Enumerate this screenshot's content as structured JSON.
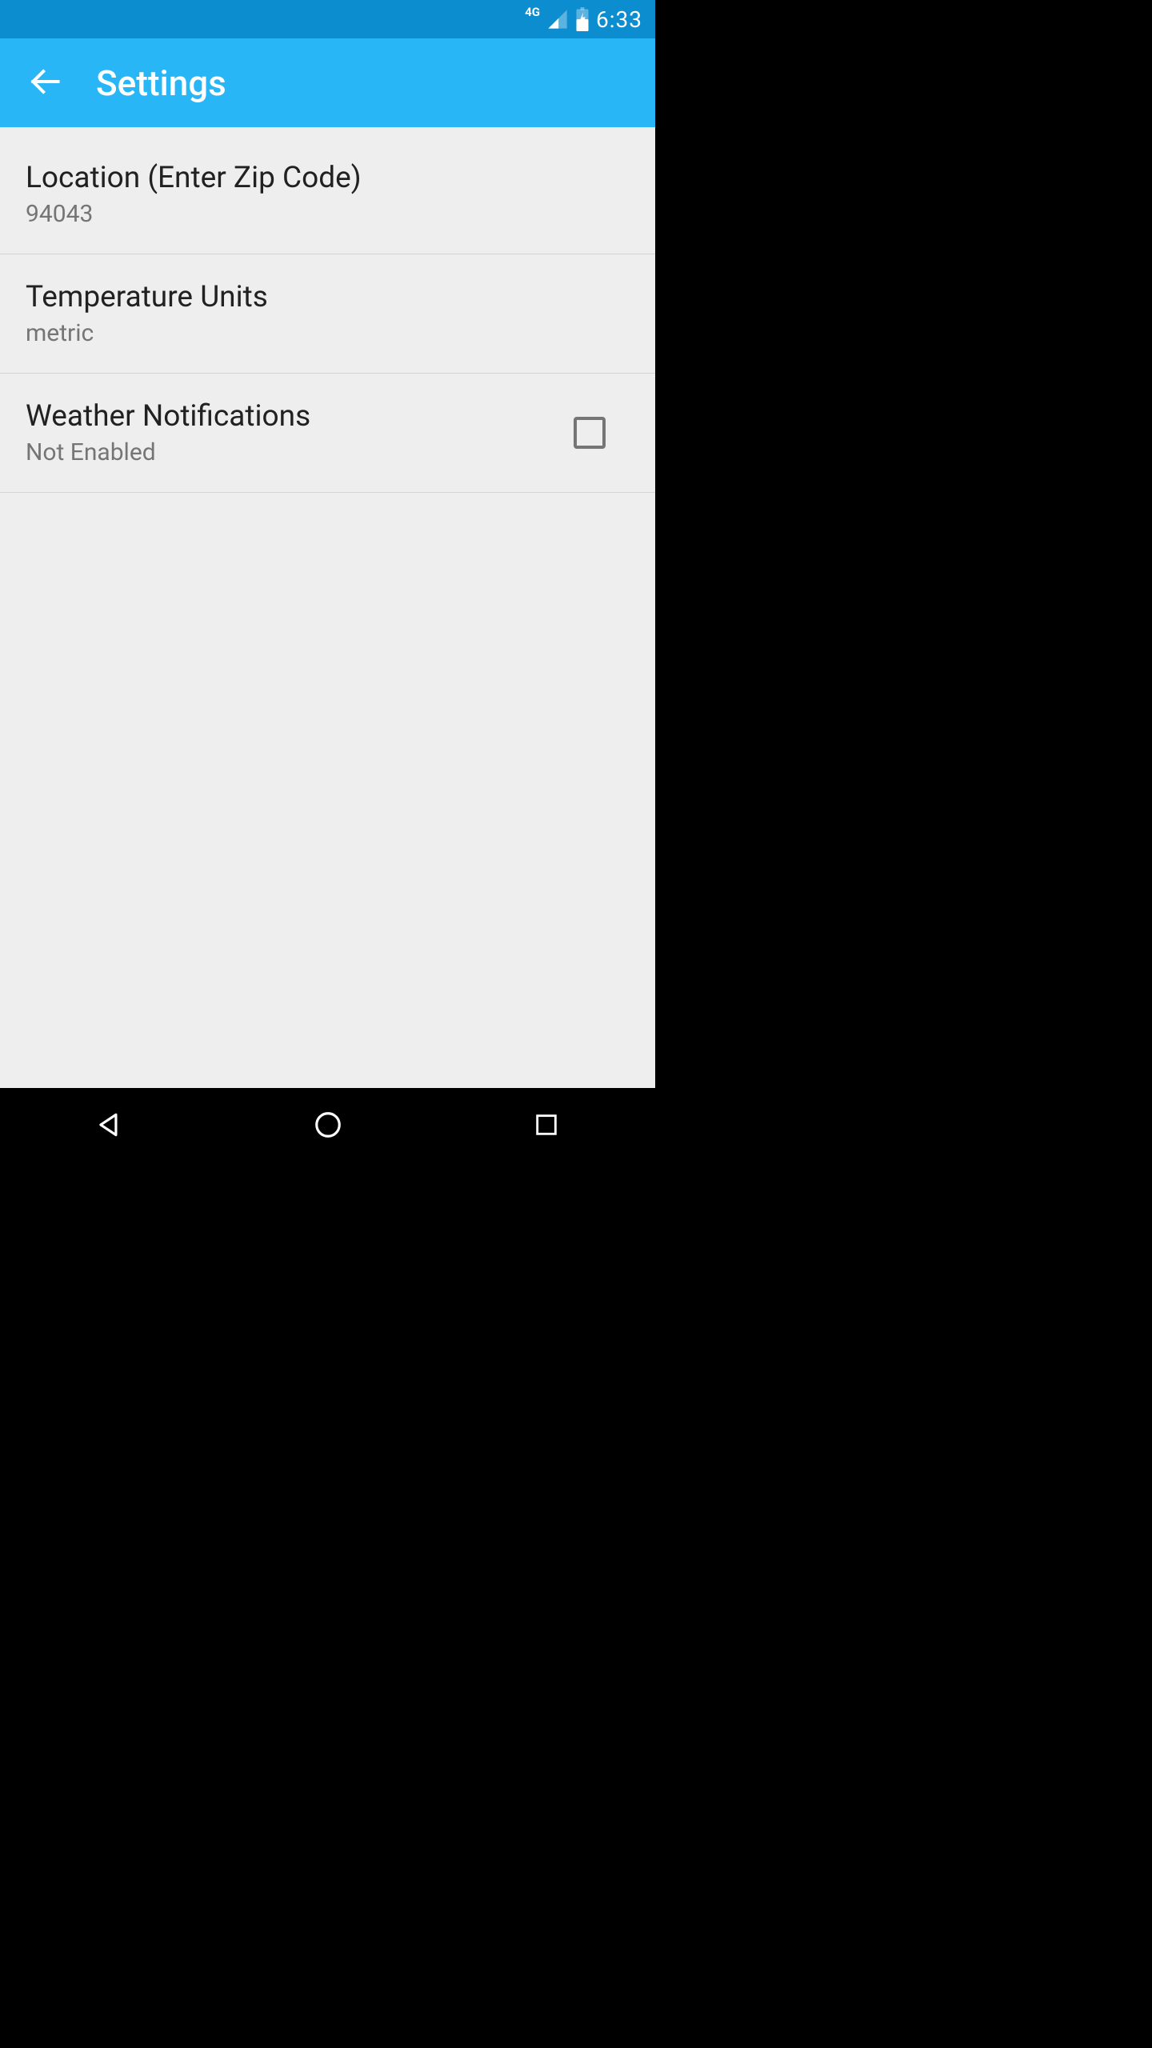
{
  "status_bar": {
    "network_label": "4G",
    "time": "6:33"
  },
  "app_bar": {
    "title": "Settings"
  },
  "settings": {
    "location": {
      "title": "Location (Enter Zip Code)",
      "value": "94043"
    },
    "temperature": {
      "title": "Temperature Units",
      "value": "metric"
    },
    "notifications": {
      "title": "Weather Notifications",
      "value": "Not Enabled",
      "checked": false
    }
  }
}
